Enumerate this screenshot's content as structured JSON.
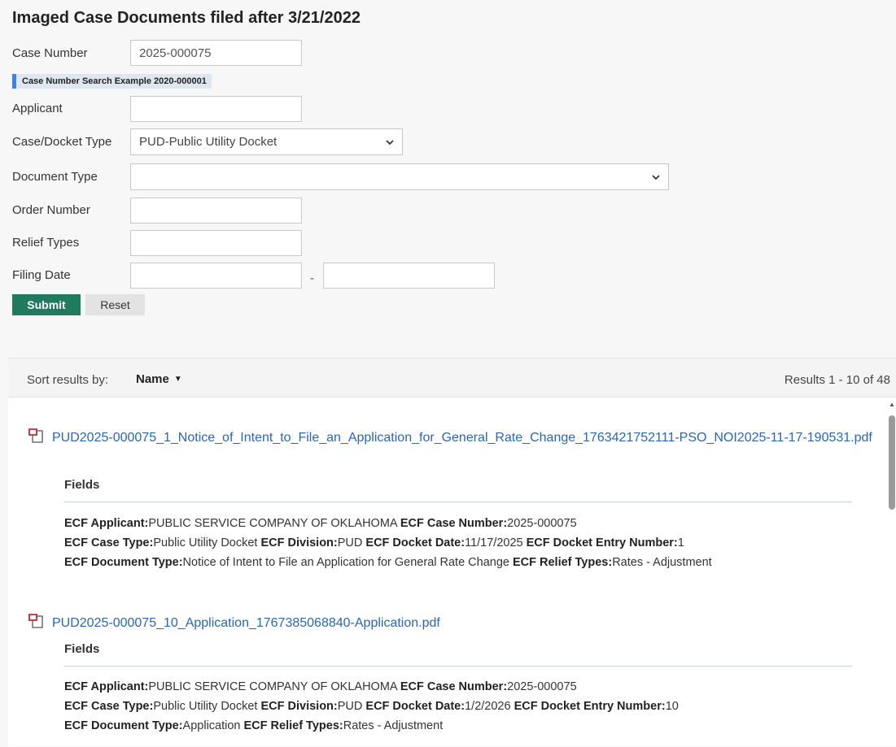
{
  "form": {
    "title": "Imaged Case Documents filed after 3/21/2022",
    "case_number_label": "Case Number",
    "case_number_value": "2025-000075",
    "hint": "Case Number Search Example 2020-000001",
    "applicant_label": "Applicant",
    "applicant_value": "",
    "docket_type_label": "Case/Docket Type",
    "docket_type_value": "PUD-Public Utility Docket",
    "document_type_label": "Document Type",
    "document_type_value": "",
    "order_number_label": "Order Number",
    "order_number_value": "",
    "relief_types_label": "Relief Types",
    "relief_types_value": "",
    "filing_date_label": "Filing Date",
    "filing_date_from": "",
    "filing_date_to": "",
    "date_separator": "-",
    "submit_label": "Submit",
    "reset_label": "Reset"
  },
  "results_header": {
    "sort_label": "Sort results by:",
    "sort_value": "Name",
    "count": "Results  1 - 10 of 48"
  },
  "results": [
    {
      "title": "PUD2025-000075_1_Notice_of_Intent_to_File_an_Application_for_General_Rate_Change_1763421752111-PSO_NOI2025-11-17-190531.pdf",
      "fields_label": "Fields",
      "applicant_key": "ECF Applicant:",
      "applicant": "PUBLIC SERVICE COMPANY OF OKLAHOMA",
      "case_number_key": "ECF Case Number:",
      "case_number": "2025-000075",
      "case_type_key": "ECF Case Type:",
      "case_type": "Public Utility Docket",
      "division_key": "ECF Division:",
      "division": "PUD",
      "docket_date_key": "ECF Docket Date:",
      "docket_date": "11/17/2025",
      "entry_number_key": "ECF Docket Entry Number:",
      "entry_number": "1",
      "doc_type_key": "ECF Document Type:",
      "doc_type": "Notice of Intent to File an Application for General Rate Change",
      "relief_types_key": "ECF Relief Types:",
      "relief_types": "Rates - Adjustment"
    },
    {
      "title": "PUD2025-000075_10_Application_1767385068840-Application.pdf",
      "fields_label": "Fields",
      "applicant_key": "ECF Applicant:",
      "applicant": "PUBLIC SERVICE COMPANY OF OKLAHOMA",
      "case_number_key": "ECF Case Number:",
      "case_number": "2025-000075",
      "case_type_key": "ECF Case Type:",
      "case_type": "Public Utility Docket",
      "division_key": "ECF Division:",
      "division": "PUD",
      "docket_date_key": "ECF Docket Date:",
      "docket_date": "1/2/2026",
      "entry_number_key": "ECF Docket Entry Number:",
      "entry_number": "10",
      "doc_type_key": "ECF Document Type:",
      "doc_type": "Application",
      "relief_types_key": "ECF Relief Types:",
      "relief_types": "Rates - Adjustment"
    }
  ],
  "icons": {
    "pdf": "pdf-file-icon",
    "chevron": "chevron-down-icon",
    "caret": "caret-down-icon",
    "scroll_up": "scroll-up-arrow-icon"
  },
  "colors": {
    "submit": "#217a5e",
    "link": "#2a67b0",
    "hint_accent": "#3a83e8",
    "pdf_icon": "#c8242e"
  }
}
